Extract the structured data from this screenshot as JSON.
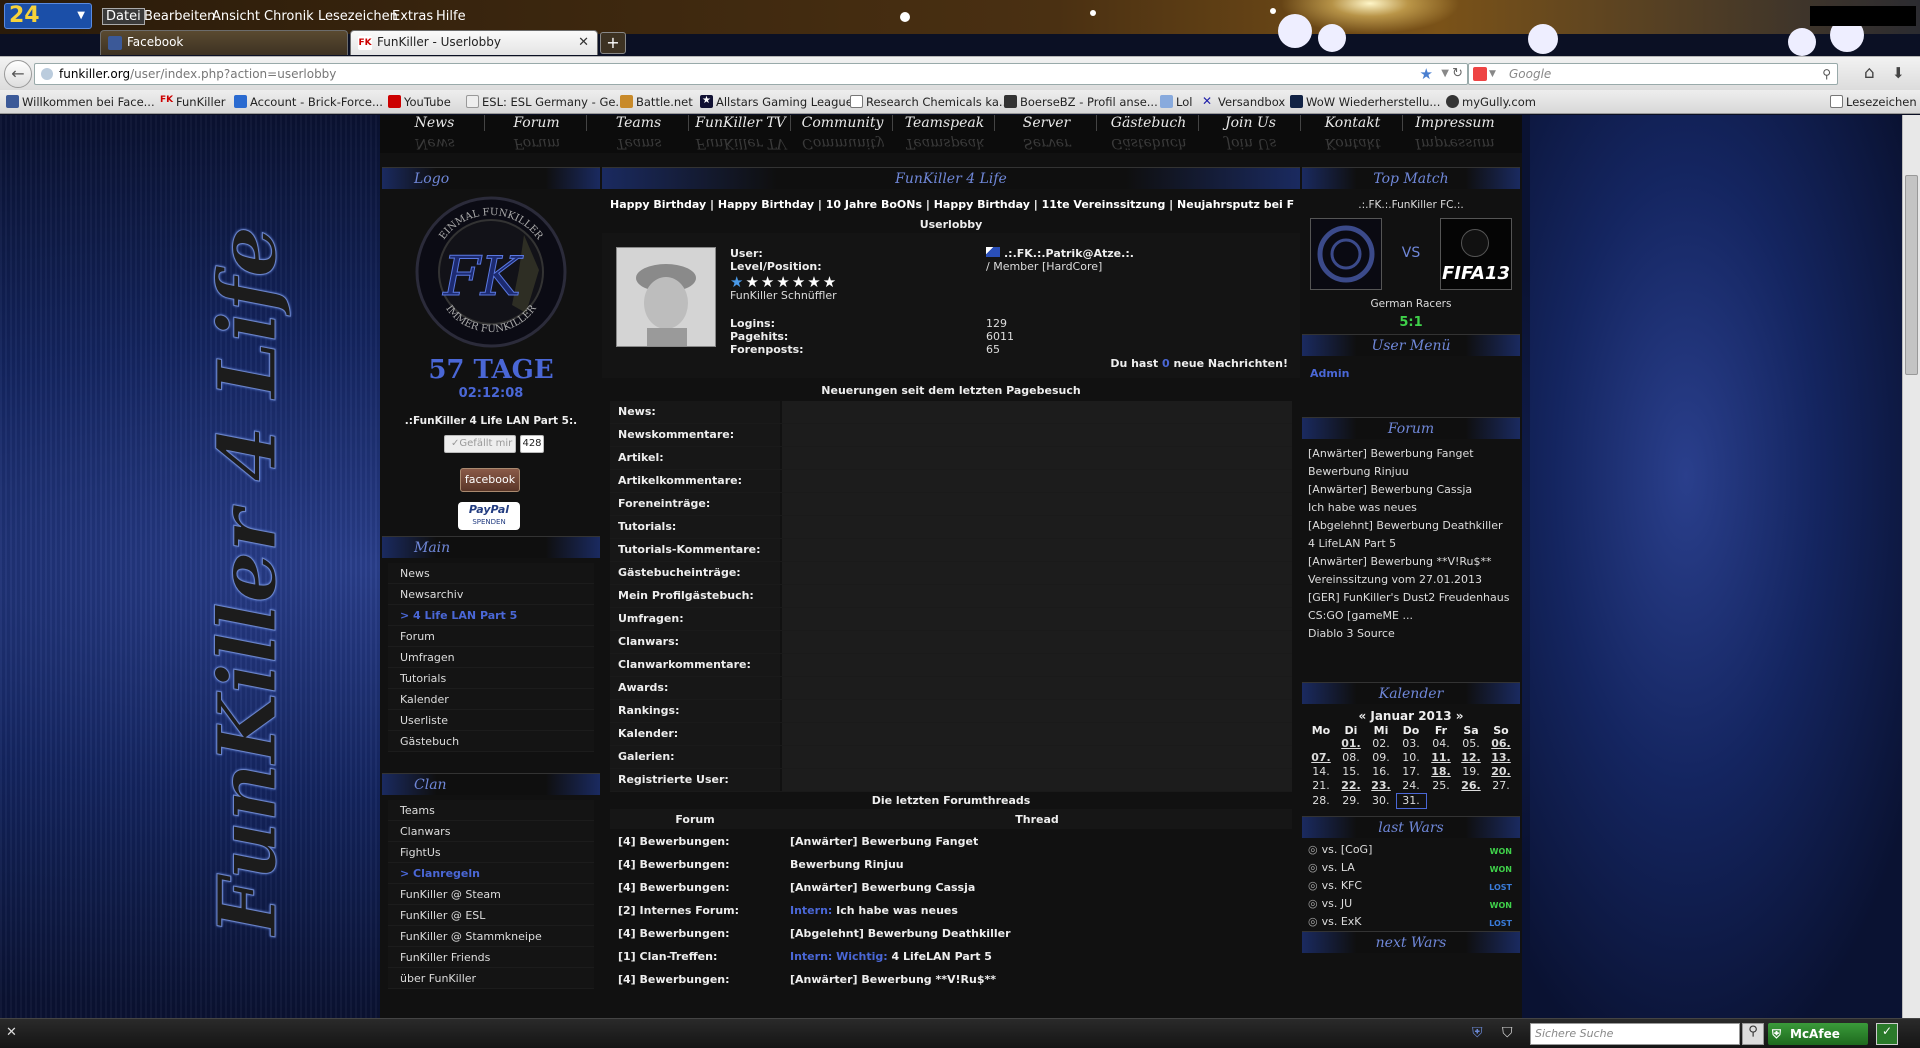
{
  "browser": {
    "logo": "24",
    "menu": [
      "Datei",
      "Bearbeiten",
      "Ansicht",
      "Chronik",
      "Lesezeichen",
      "Extras",
      "Hilfe"
    ],
    "tabs": [
      {
        "title": "Facebook",
        "favicon": "facebook-icon"
      },
      {
        "title": "FunKiller - Userlobby",
        "favicon": "fk-icon"
      }
    ],
    "new_tab": "+",
    "url_host": "funkiller.org",
    "url_path": "/user/index.php?action=userlobby",
    "search_placeholder": "Google",
    "bookmarks": [
      "Willkommen bei Face...",
      "FunKiller",
      "Account - Brick-Force...",
      "YouTube",
      "ESL: ESL Germany - Ge...",
      "Battle.net",
      "Allstars Gaming League",
      "Research Chemicals ka...",
      "BoerseBZ - Profil anse...",
      "Lol",
      "Versandbox",
      "WoW Wiederherstellu...",
      "myGully.com"
    ],
    "bookmarks_right": "Lesezeichen",
    "status_search_placeholder": "Sichere Suche",
    "mcafee": "McAfee",
    "accent": "#1b4fa8"
  },
  "site": {
    "watermark": "FunKiller 4 Life",
    "nav": [
      "News",
      "Forum",
      "Teams",
      "FunKiller TV",
      "Community",
      "Teamspeak",
      "Server",
      "Gästebuch",
      "Join Us",
      "Kontakt",
      "Impressum"
    ],
    "left": {
      "logo_head": "Logo",
      "logo_ring_top": "EINMAL FUNKILLER",
      "logo_ring_bottom": "IMMER FUNKILLER",
      "logo_letters": "FK",
      "countdown_days": "57 TAGE",
      "countdown_time": "02:12:08",
      "event": ".:FunKiller 4 Life LAN Part 5:.",
      "like_label": "Gefällt mir",
      "like_count": "428",
      "facebook_label": "facebook",
      "paypal_label": "PayPal",
      "paypal_sub": "SPENDEN",
      "main_head": "Main",
      "main_items": [
        {
          "label": "News",
          "active": false
        },
        {
          "label": "Newsarchiv",
          "active": false
        },
        {
          "label": "> 4 Life LAN Part 5",
          "active": true
        },
        {
          "label": "Forum",
          "active": false
        },
        {
          "label": "Umfragen",
          "active": false
        },
        {
          "label": "Tutorials",
          "active": false
        },
        {
          "label": "Kalender",
          "active": false
        },
        {
          "label": "Userliste",
          "active": false
        },
        {
          "label": "Gästebuch",
          "active": false
        }
      ],
      "clan_head": "Clan",
      "clan_items": [
        {
          "label": "Teams",
          "active": false
        },
        {
          "label": "Clanwars",
          "active": false
        },
        {
          "label": "FightUs",
          "active": false
        },
        {
          "label": "> Clanregeln",
          "active": true
        },
        {
          "label": "FunKiller @ Steam",
          "active": false
        },
        {
          "label": "FunKiller @ ESL",
          "active": false
        },
        {
          "label": "FunKiller @ Stammkneipe",
          "active": false
        },
        {
          "label": "FunKiller Friends",
          "active": false
        },
        {
          "label": "über FunKiller",
          "active": false
        }
      ]
    },
    "center": {
      "head": "FunKiller 4 Life",
      "ticker": [
        "Happy Birthday",
        "Happy Birthday",
        "10 Jahre BoONs",
        "Happy Birthday",
        "11te Vereinssitzung",
        "Neujahrsputz bei FunKill"
      ],
      "section_title": "Userlobby",
      "user_label": "User:",
      "user_value": ".:.FK.:.Patrik@Atze.:.",
      "level_label": "Level/Position:",
      "level_value": "/ Member [HardCore]",
      "stars": 7,
      "rank": "FunKiller Schnüffler",
      "logins_label": "Logins:",
      "logins_value": "129",
      "pagehits_label": "Pagehits:",
      "pagehits_value": "6011",
      "posts_label": "Forenposts:",
      "posts_value": "65",
      "messages_pre": "Du hast ",
      "messages_count": "0",
      "messages_post": " neue Nachrichten!",
      "news_title": "Neuerungen seit dem letzten Pagebesuch",
      "news_rows": [
        "News:",
        "Newskommentare:",
        "Artikel:",
        "Artikelkommentare:",
        "Foreneinträge:",
        "Tutorials:",
        "Tutorials-Kommentare:",
        "Gästebucheinträge:",
        "Mein Profilgästebuch:",
        "Umfragen:",
        "Clanwars:",
        "Clanwarkommentare:",
        "Awards:",
        "Rankings:",
        "Kalender:",
        "Galerien:",
        "Registrierte User:"
      ],
      "threads_title": "Die letzten Forumthreads",
      "threads_col_forum": "Forum",
      "threads_col_thread": "Thread",
      "threads": [
        {
          "forum": "[4] Bewerbungen:",
          "prefix": "",
          "thread": "[Anwärter] Bewerbung Fanget"
        },
        {
          "forum": "[4] Bewerbungen:",
          "prefix": "",
          "thread": "Bewerbung Rinjuu"
        },
        {
          "forum": "[4] Bewerbungen:",
          "prefix": "",
          "thread": "[Anwärter] Bewerbung Cassja"
        },
        {
          "forum": "[2] Internes Forum:",
          "prefix": "Intern: ",
          "thread": "Ich habe was neues"
        },
        {
          "forum": "[4] Bewerbungen:",
          "prefix": "",
          "thread": "[Abgelehnt] Bewerbung Deathkiller"
        },
        {
          "forum": "[1] Clan-Treffen:",
          "prefix": "Intern: Wichtig: ",
          "thread": "4 LifeLAN Part 5"
        },
        {
          "forum": "[4] Bewerbungen:",
          "prefix": "",
          "thread": "[Anwärter] Bewerbung **V!Ru$**"
        }
      ]
    },
    "right": {
      "top_match_head": "Top Match",
      "match_team": ".:.FK.:.FunKiller FC.:.",
      "match_vs": "VS",
      "match_game": "FIFA13",
      "match_opponent": "German Racers",
      "match_score": "5:1",
      "usermenu_head": "User Menü",
      "usermenu_items": [
        "Admin"
      ],
      "forum_head": "Forum",
      "forum_items": [
        "[Anwärter] Bewerbung Fanget",
        "Bewerbung Rinjuu",
        "[Anwärter] Bewerbung Cassja",
        "Ich habe was neues",
        "[Abgelehnt] Bewerbung Deathkiller",
        "4 LifeLAN Part 5",
        "[Anwärter] Bewerbung **V!Ru$**",
        "Vereinssitzung vom 27.01.2013",
        "[GER] FunKiller's Dust2 Freudenhaus CS:GO [gameME ...",
        "Diablo 3 Source"
      ],
      "calendar_head": "Kalender",
      "calendar_title": "« Januar 2013 »",
      "calendar_days": [
        "Mo",
        "Di",
        "Mi",
        "Do",
        "Fr",
        "Sa",
        "So"
      ],
      "calendar_weeks": [
        [
          "",
          "01.",
          "02.",
          "03.",
          "04.",
          "05.",
          "06."
        ],
        [
          "07.",
          "08.",
          "09.",
          "10.",
          "11.",
          "12.",
          "13."
        ],
        [
          "14.",
          "15.",
          "16.",
          "17.",
          "18.",
          "19.",
          "20."
        ],
        [
          "21.",
          "22.",
          "23.",
          "24.",
          "25.",
          "26.",
          "27."
        ],
        [
          "28.",
          "29.",
          "30.",
          "31.",
          "",
          "",
          ""
        ]
      ],
      "calendar_underlined": [
        "01.",
        "06.",
        "07.",
        "11.",
        "12.",
        "13.",
        "18.",
        "20.",
        "22.",
        "23.",
        "26."
      ],
      "calendar_today": "31.",
      "lastwars_head": "last Wars",
      "lastwars": [
        {
          "label": "vs. [CoG]",
          "result": "WON"
        },
        {
          "label": "vs. LA",
          "result": "WON"
        },
        {
          "label": "vs. KFC",
          "result": "LOST"
        },
        {
          "label": "vs. JU",
          "result": "WON"
        },
        {
          "label": "vs. ExK",
          "result": "LOST"
        }
      ],
      "nextwars_head": "next Wars"
    },
    "colors": {
      "accent": "#4a67d6",
      "won": "#3fd14a",
      "lost": "#3a7bd8"
    }
  }
}
